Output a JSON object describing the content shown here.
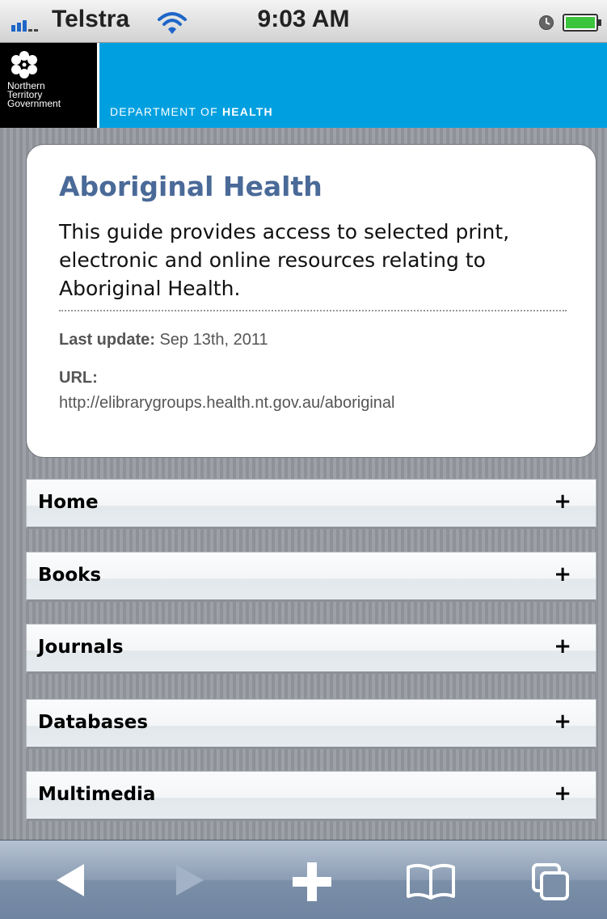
{
  "status_bar": {
    "carrier": "Telstra",
    "time": "9:03 AM"
  },
  "banner": {
    "logo_lines": [
      "Northern",
      "Territory",
      "Government"
    ],
    "department_prefix": "DEPARTMENT OF",
    "department_name": "HEALTH"
  },
  "guide": {
    "title": "Aboriginal Health",
    "description": "This guide provides access to selected print, electronic and online resources relating to Aboriginal Health.",
    "last_update_label": "Last update:",
    "last_update_value": "Sep 13th, 2011",
    "url_label": "URL:",
    "url_value": "http://elibrarygroups.health.nt.gov.au/aboriginal"
  },
  "sections": [
    {
      "label": "Home",
      "toggle": "+"
    },
    {
      "label": "Books",
      "toggle": "+"
    },
    {
      "label": "Journals",
      "toggle": "+"
    },
    {
      "label": "Databases",
      "toggle": "+"
    },
    {
      "label": "Multimedia",
      "toggle": "+"
    }
  ],
  "toolbar": {
    "icons": [
      "back-arrow-icon",
      "forward-arrow-icon",
      "add-plus-icon",
      "bookmarks-book-icon",
      "pages-tabs-icon"
    ]
  },
  "colors": {
    "banner_blue": "#00a0e0",
    "title_blue": "#4a6a98"
  }
}
